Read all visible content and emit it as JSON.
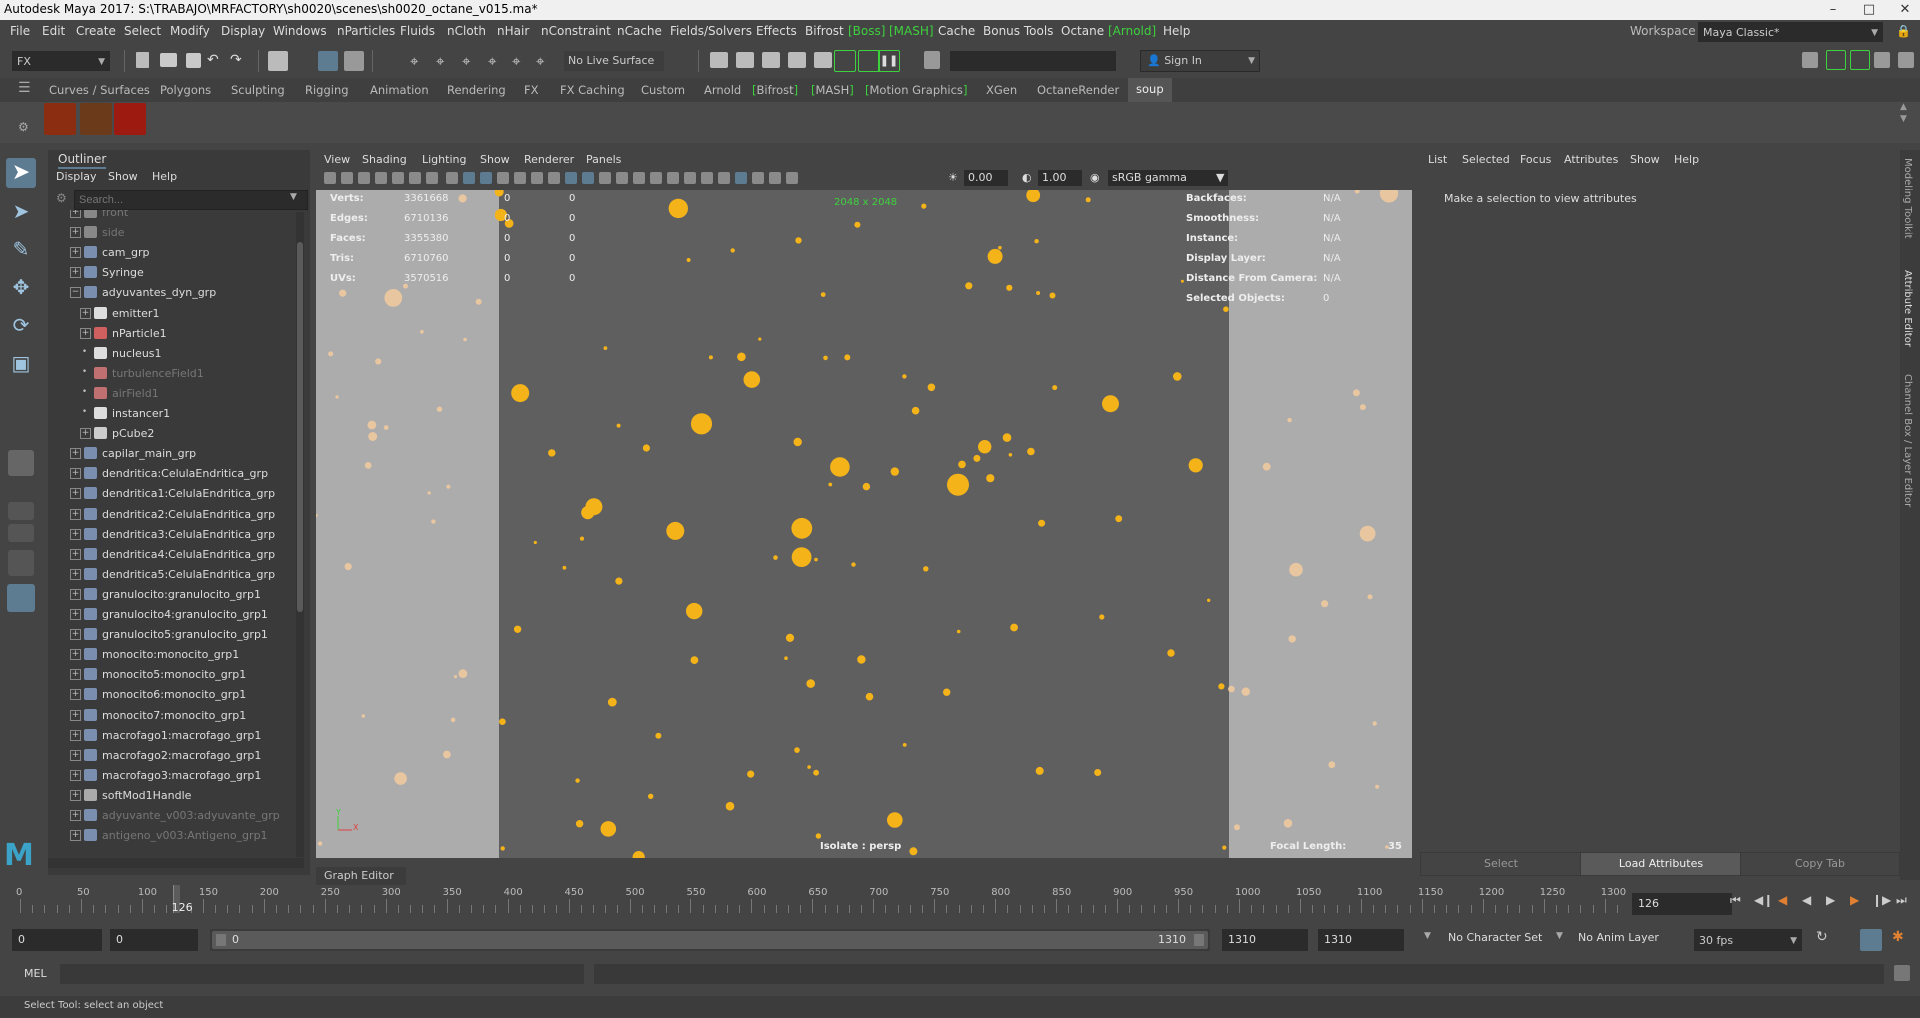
{
  "window": {
    "title": "Autodesk Maya 2017: S:\\TRABAJO\\MRFACTORY\\sh0020\\scenes\\sh0020_octane_v015.ma*"
  },
  "menubar": {
    "items": [
      "File",
      "Edit",
      "Create",
      "Select",
      "Modify",
      "Display",
      "Windows",
      "nParticles",
      "Fluids",
      "nCloth",
      "nHair",
      "nConstraint",
      "nCache",
      "Fields/Solvers",
      "Effects",
      "Bifrost",
      "[Boss]",
      "[MASH]",
      "Cache",
      "Bonus Tools",
      "Octane",
      "[Arnold]",
      "Help"
    ],
    "workspace_label": "Workspace :",
    "workspace_value": "Maya Classic*"
  },
  "statusline": {
    "menuset": "FX",
    "live_surface": "No Live Surface",
    "sign_in": "Sign In"
  },
  "shelf": {
    "tabs": [
      "Curves / Surfaces",
      "Polygons",
      "Sculpting",
      "Rigging",
      "Animation",
      "Rendering",
      "FX",
      "FX Caching",
      "Custom",
      "Arnold",
      "Bifrost",
      "MASH",
      "Motion Graphics",
      "XGen",
      "OctaneRender",
      "soup"
    ],
    "active_tab": "soup"
  },
  "outliner": {
    "title": "Outliner",
    "menu": [
      "Display",
      "Show",
      "Help"
    ],
    "search_placeholder": "Search...",
    "rows": [
      {
        "label": "front",
        "dim": true,
        "indent": 0,
        "icon": "camera-icon"
      },
      {
        "label": "side",
        "dim": true,
        "indent": 0,
        "icon": "camera-icon"
      },
      {
        "label": "cam_grp",
        "dim": false,
        "indent": 0,
        "icon": "group-icon"
      },
      {
        "label": "Syringe",
        "dim": false,
        "indent": 0,
        "icon": "group-icon"
      },
      {
        "label": "adyuvantes_dyn_grp",
        "dim": false,
        "indent": 0,
        "icon": "group-icon"
      },
      {
        "label": "emitter1",
        "dim": false,
        "indent": 1,
        "icon": "emitter-icon"
      },
      {
        "label": "nParticle1",
        "dim": false,
        "indent": 1,
        "icon": "nparticle-icon"
      },
      {
        "label": "nucleus1",
        "dim": false,
        "indent": 1,
        "icon": "nucleus-icon"
      },
      {
        "label": "turbulenceField1",
        "dim": true,
        "indent": 1,
        "icon": "field-icon"
      },
      {
        "label": "airField1",
        "dim": true,
        "indent": 1,
        "icon": "field-icon"
      },
      {
        "label": "instancer1",
        "dim": false,
        "indent": 1,
        "icon": "instancer-icon"
      },
      {
        "label": "pCube2",
        "dim": false,
        "indent": 1,
        "icon": "mesh-icon"
      },
      {
        "label": "capilar_main_grp",
        "dim": false,
        "indent": 0,
        "icon": "group-icon"
      },
      {
        "label": "dendritica:CelulaEndritica_grp",
        "dim": false,
        "indent": 0,
        "icon": "group-icon"
      },
      {
        "label": "dendritica1:CelulaEndritica_grp",
        "dim": false,
        "indent": 0,
        "icon": "group-icon"
      },
      {
        "label": "dendritica2:CelulaEndritica_grp",
        "dim": false,
        "indent": 0,
        "icon": "group-icon"
      },
      {
        "label": "dendritica3:CelulaEndritica_grp",
        "dim": false,
        "indent": 0,
        "icon": "group-icon"
      },
      {
        "label": "dendritica4:CelulaEndritica_grp",
        "dim": false,
        "indent": 0,
        "icon": "group-icon"
      },
      {
        "label": "dendritica5:CelulaEndritica_grp",
        "dim": false,
        "indent": 0,
        "icon": "group-icon"
      },
      {
        "label": "granulocito:granulocito_grp1",
        "dim": false,
        "indent": 0,
        "icon": "group-icon"
      },
      {
        "label": "granulocito4:granulocito_grp1",
        "dim": false,
        "indent": 0,
        "icon": "group-icon"
      },
      {
        "label": "granulocito5:granulocito_grp1",
        "dim": false,
        "indent": 0,
        "icon": "group-icon"
      },
      {
        "label": "monocito:monocito_grp1",
        "dim": false,
        "indent": 0,
        "icon": "group-icon"
      },
      {
        "label": "monocito5:monocito_grp1",
        "dim": false,
        "indent": 0,
        "icon": "group-icon"
      },
      {
        "label": "monocito6:monocito_grp1",
        "dim": false,
        "indent": 0,
        "icon": "group-icon"
      },
      {
        "label": "monocito7:monocito_grp1",
        "dim": false,
        "indent": 0,
        "icon": "group-icon"
      },
      {
        "label": "macrofago1:macrofago_grp1",
        "dim": false,
        "indent": 0,
        "icon": "group-icon"
      },
      {
        "label": "macrofago2:macrofago_grp1",
        "dim": false,
        "indent": 0,
        "icon": "group-icon"
      },
      {
        "label": "macrofago3:macrofago_grp1",
        "dim": false,
        "indent": 0,
        "icon": "group-icon"
      },
      {
        "label": "softMod1Handle",
        "dim": false,
        "indent": 0,
        "icon": "softmod-icon"
      },
      {
        "label": "adyuvante_v003:adyuvante_grp",
        "dim": true,
        "indent": 0,
        "icon": "group-icon"
      },
      {
        "label": "antigeno_v003:Antigeno_grp1",
        "dim": true,
        "indent": 0,
        "icon": "group-icon"
      }
    ]
  },
  "viewport": {
    "menu": [
      "View",
      "Shading",
      "Lighting",
      "Show",
      "Renderer",
      "Panels"
    ],
    "exposure": "0.00",
    "gamma": "1.00",
    "color_space": "sRGB gamma",
    "resolution_gate": "2048 x 2048",
    "hud_left": [
      {
        "label": "Verts:",
        "value": "3361668",
        "a": "0",
        "b": "0"
      },
      {
        "label": "Edges:",
        "value": "6710136",
        "a": "0",
        "b": "0"
      },
      {
        "label": "Faces:",
        "value": "3355380",
        "a": "0",
        "b": "0"
      },
      {
        "label": "Tris:",
        "value": "6710760",
        "a": "0",
        "b": "0"
      },
      {
        "label": "UVs:",
        "value": "3570516",
        "a": "0",
        "b": "0"
      }
    ],
    "hud_right": [
      {
        "label": "Backfaces:",
        "value": "N/A"
      },
      {
        "label": "Smoothness:",
        "value": "N/A"
      },
      {
        "label": "Instance:",
        "value": "N/A"
      },
      {
        "label": "Display Layer:",
        "value": "N/A"
      },
      {
        "label": "Distance From Camera:",
        "value": "N/A"
      },
      {
        "label": "Selected Objects:",
        "value": "0"
      }
    ],
    "isolate": "Isolate : persp",
    "focal_label": "Focal Length:",
    "focal_value": "35",
    "axis_y": "Y",
    "axis_x": "X",
    "particle_color": "#f5b31a",
    "gate_particle_color": "#e8c6a0"
  },
  "graph_editor_tab": "Graph Editor",
  "attribute_editor": {
    "menu": [
      "List",
      "Selected",
      "Focus",
      "Attributes",
      "Show",
      "Help"
    ],
    "message": "Make a selection to view attributes",
    "buttons": [
      "Select",
      "Load Attributes",
      "Copy Tab"
    ]
  },
  "side_tabs": [
    "Modeling Toolkit",
    "Attribute Editor",
    "Channel Box / Layer Editor"
  ],
  "time_slider": {
    "ticks": [
      "0",
      "50",
      "100",
      "150",
      "200",
      "250",
      "300",
      "350",
      "400",
      "450",
      "500",
      "550",
      "600",
      "650",
      "700",
      "750",
      "800",
      "850",
      "900",
      "950",
      "1000",
      "1050",
      "1100",
      "1150",
      "1200",
      "1250",
      "1300"
    ],
    "current_frame_label": "126",
    "current_frame_field": "126",
    "current_frame": 126,
    "max_frame": 1310
  },
  "range_slider": {
    "start": "0",
    "playback_start": "0",
    "range_start": "0",
    "range_end": "1310",
    "playback_end": "1310",
    "end": "1310",
    "character_set": "No Character Set",
    "anim_layer": "No Anim Layer",
    "fps": "30 fps"
  },
  "command_line": {
    "label": "MEL"
  },
  "help_line": {
    "text": "Select Tool: select an object"
  }
}
